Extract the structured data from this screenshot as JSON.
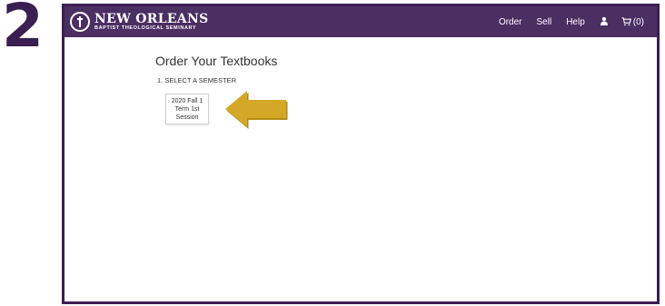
{
  "step_number": "2",
  "header": {
    "logo_title": "NEW ORLEANS",
    "logo_subtitle": "BAPTIST THEOLOGICAL SEMINARY",
    "nav": {
      "order": "Order",
      "sell": "Sell",
      "help": "Help"
    },
    "cart_count": "(0)",
    "background_color": "#4b2e62"
  },
  "main": {
    "title": "Order Your Textbooks",
    "step_label": "1. SELECT A SEMESTER",
    "semester_button": "2020 Fall 1 Term 1st Session"
  },
  "annotation": {
    "arrow_color": "#d4a826"
  },
  "icons": [
    "user-icon",
    "cart-icon",
    "logo-emblem-icon",
    "pointer-arrow-icon"
  ]
}
